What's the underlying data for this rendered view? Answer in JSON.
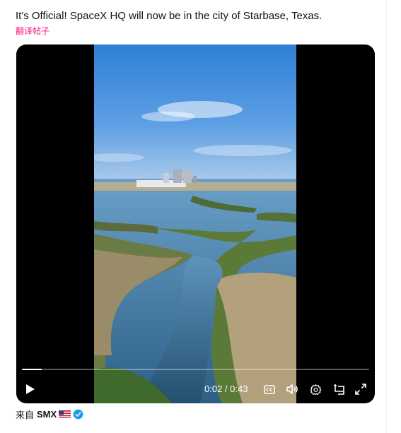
{
  "post": {
    "text": "It's Official! SpaceX HQ will now be in the city of Starbase, Texas.",
    "translate_label": "翻译帖子"
  },
  "video": {
    "current_time": "0:02",
    "duration": "0:43",
    "time_display": "0:02 / 0:43",
    "progress_fraction": 0.057,
    "controls": [
      "play-icon",
      "captions-icon",
      "volume-icon",
      "settings-icon",
      "pip-icon",
      "fullscreen-icon"
    ]
  },
  "source": {
    "from_label": "来自",
    "author": "SMX",
    "flag": "us-flag-icon",
    "verified_color": "#1d9bf0"
  },
  "colors": {
    "text": "#0f1419",
    "link": "#f91880",
    "verified": "#1d9bf0"
  }
}
